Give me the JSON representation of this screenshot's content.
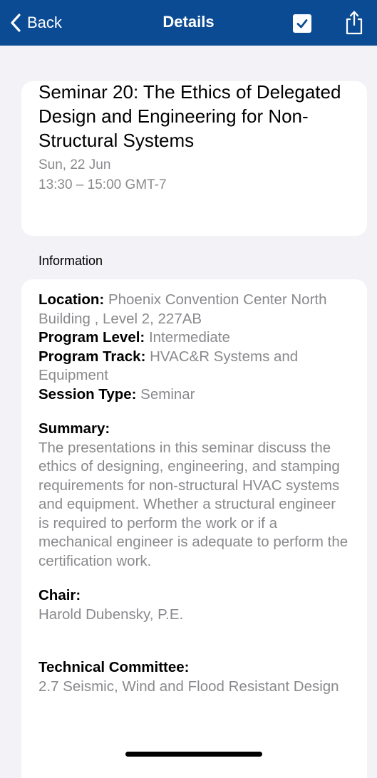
{
  "nav": {
    "back_label": "Back",
    "title": "Details",
    "bar_color": "#0b4b93"
  },
  "session": {
    "title": "Seminar 20: The Ethics of Delegated Design and Engineering for Non-Structural Systems",
    "date": "Sun, 22 Jun",
    "time": "13:30 – 15:00 GMT-7"
  },
  "info": {
    "section_header": "Information",
    "location_label": "Location:",
    "location_value": "Phoenix Convention Center North Building , Level 2, 227AB",
    "level_label": "Program Level:",
    "level_value": "Intermediate",
    "track_label": "Program Track:",
    "track_value": "HVAC&R Systems and Equipment",
    "type_label": "Session Type:",
    "type_value": "Seminar",
    "summary_label": "Summary:",
    "summary_value": "The presentations in this seminar discuss the ethics of designing, engineering, and stamping requirements for non-structural HVAC systems and equipment. Whether a structural engineer is required to perform the work or if a mechanical engineer is adequate to perform the certification work.",
    "chair_label": "Chair:",
    "chair_value": "Harold Dubensky, P.E.",
    "committee_label": "Technical Committee:",
    "committee_value": "2.7 Seismic, Wind and Flood Resistant Design"
  },
  "icons": {
    "back": "chevron-left-icon",
    "checkbox": "checkbox-checked-icon",
    "share": "share-icon"
  }
}
